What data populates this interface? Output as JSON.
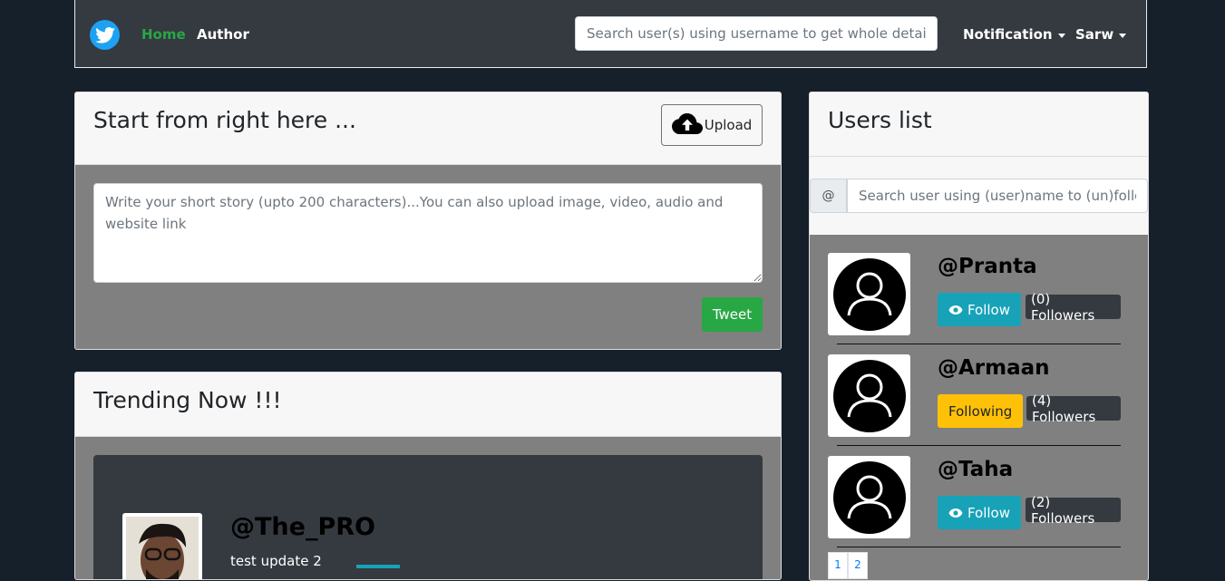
{
  "navbar": {
    "logo_icon": "twitter-bird-icon",
    "home_label": "Home",
    "author_label": "Author",
    "search_placeholder": "Search user(s) using username to get whole details ...",
    "notification_label": "Notification",
    "user_menu_label": "Sarw",
    "colors": {
      "home": "#28a745",
      "logo": "#1da1f2"
    }
  },
  "compose": {
    "title": "Start from right here ...",
    "upload_label": "Upload",
    "upload_icon": "cloud-upload-icon",
    "textarea_placeholder": "Write your short story (upto 200 characters)...You can also upload image, video, audio and website link",
    "tweet_label": "Tweet"
  },
  "trending": {
    "title": "Trending Now !!!",
    "tweets": [
      {
        "username": "@The_PRO",
        "text": "test update 2"
      }
    ]
  },
  "users_list": {
    "title": "Users list",
    "search_prefix": "@",
    "search_placeholder": "Search user using (user)name to (un)follow.",
    "users": [
      {
        "name": "@Pranta",
        "button": "Follow",
        "followers": "(0) Followers"
      },
      {
        "name": "@Armaan",
        "button": "Following",
        "followers": "(4) Followers"
      },
      {
        "name": "@Taha",
        "button": "Follow",
        "followers": "(2) Followers"
      }
    ],
    "pages": [
      "1",
      "2"
    ]
  }
}
